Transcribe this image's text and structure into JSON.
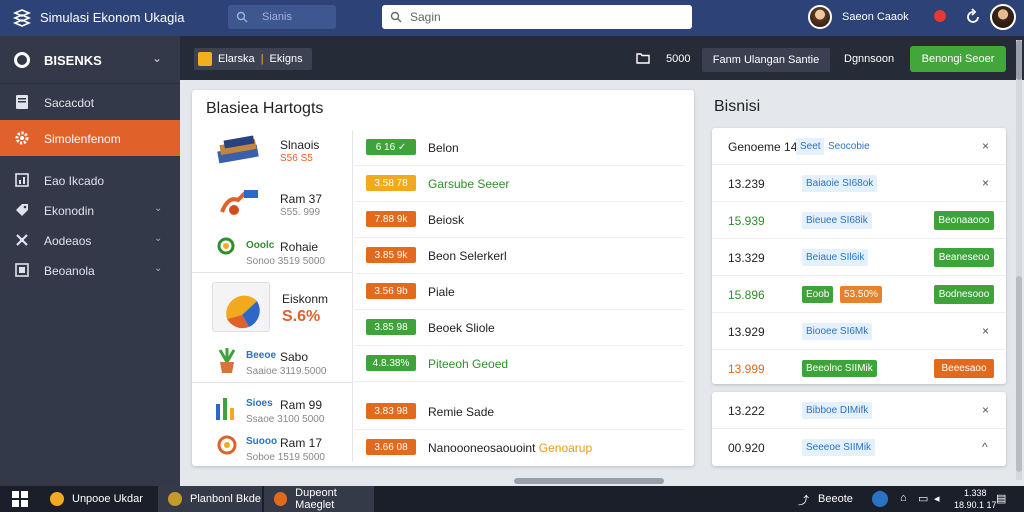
{
  "topbar": {
    "title": "Simulasi Ekonom Ukagia",
    "search_left": "Sianis",
    "search_main": "Sagin",
    "user_name": "Saeon Caaok"
  },
  "sidebar": {
    "header": "BISENKS",
    "items": [
      {
        "label": "Sacacdot",
        "icon": "document-icon"
      },
      {
        "label": "Simolenfenom",
        "icon": "gear-icon",
        "active": true
      },
      {
        "label": "Eao Ikcado",
        "icon": "chart-icon"
      },
      {
        "label": "Ekonodin",
        "icon": "tag-icon"
      },
      {
        "label": "Aodeaos",
        "icon": "tools-icon"
      },
      {
        "label": "Beoanola",
        "icon": "grid-icon"
      }
    ]
  },
  "toolbar": {
    "tab_label": "Elarska",
    "tab_sub": "Ekigns",
    "count": "5000",
    "button1": "Fanm Ulangan Santie",
    "label": "Dgnnsoon",
    "button2": "Benongi Seoer"
  },
  "left_panel": {
    "title": "Blasiea Hartogts",
    "products": [
      {
        "name": "Slnaois",
        "sub": "S56 S5",
        "sub_color": "#e0622a"
      },
      {
        "name": "Ram 37",
        "sub": "S55. 999"
      },
      {
        "name": "Rohaie",
        "brand": "Ooolc",
        "sub": "Sonoo 3519 5000"
      },
      {
        "name": "Eiskonm",
        "value": "S.6%"
      },
      {
        "name": "Sabo",
        "brand": "Beeoe",
        "sub": "Saaioe 3119.5000"
      },
      {
        "name": "Ram 99",
        "brand": "Sioes",
        "sub": "Ssaoe 3100 5000"
      },
      {
        "name": "Ram 17",
        "brand": "Suooo",
        "sub": "Soboe 1519 5000"
      }
    ],
    "rows": [
      {
        "pill": "6 16 ✓",
        "color": "#3ea43a",
        "text": "Belon"
      },
      {
        "pill": "3.58 78",
        "color": "#f2a91e",
        "text": "Garsube Seeer",
        "green": true
      },
      {
        "pill": "7.88 9k",
        "color": "#e36a1d",
        "text": "Beiosk"
      },
      {
        "pill": "3.85 9k",
        "color": "#e36a1d",
        "text": "Beon Selerkerl"
      },
      {
        "pill": "3.56 9b",
        "color": "#e36a1d",
        "text": "Piale"
      },
      {
        "pill": "3.85 98",
        "color": "#3ea43a",
        "text": "Beoek Sliole"
      },
      {
        "pill": "4.8.38%",
        "color": "#3ea43a",
        "text": "Piteeoh Geoed",
        "green": true
      },
      {
        "pill": "3.83 98",
        "color": "#e36a1d",
        "text": "Remie Sade"
      },
      {
        "pill": "3.66 08",
        "color": "#e36a1d",
        "text": "Nanoooneosaouoint",
        "hl": "Genoarup"
      }
    ]
  },
  "right_panel": {
    "title": "Bisnisi",
    "header": {
      "label": "Genoeme 14",
      "tag1": "Seet",
      "tag2": "Seocobie"
    },
    "rows": [
      {
        "value": "13.239",
        "tag": "Baiaoie SI68ok"
      },
      {
        "value": "15.939",
        "tag": "Bieuee SI68ik",
        "value_class": "green",
        "action": "Beonaaooo",
        "action_color": "#3ea43a"
      },
      {
        "value": "13.329",
        "tag": "Beiaue SIl6ik",
        "action": "Beaneseoo",
        "action_color": "#3ea43a"
      },
      {
        "value": "15.896",
        "tag": "Eoob",
        "tag2": "53.50%",
        "value_class": "green",
        "action": "Bodnesooo",
        "action_color": "#3ea43a"
      },
      {
        "value": "13.929",
        "tag": "Biooee SI6Mk"
      },
      {
        "value": "13.999",
        "tag": "Beeolnc SIIMik",
        "tag_green": true,
        "value_class": "orange",
        "action": "Beeesaoo",
        "action_color": "#e36a1d"
      }
    ],
    "rows2": [
      {
        "value": "13.222",
        "tag": "Bibboe DIMifk"
      },
      {
        "value": "00.920",
        "tag": "Seeeoe SIIMik"
      }
    ]
  },
  "taskbar": {
    "apps": [
      "Unpooe Ukdar",
      "Planbonl Bkde",
      "Dupeont Maeglet"
    ],
    "tray_text": "Beeote",
    "clock_time": "1.338",
    "clock_date": "18.90.1 17"
  }
}
